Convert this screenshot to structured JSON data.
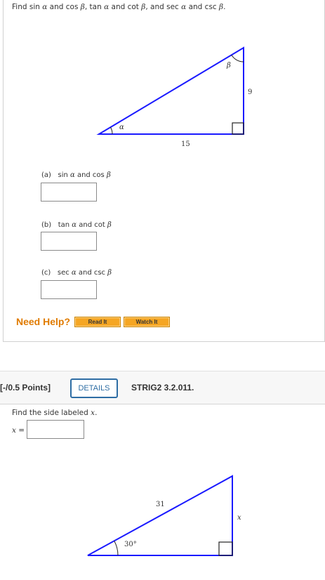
{
  "q1": {
    "prompt": {
      "t1": "Find sin ",
      "a1": "α",
      "t2": " and cos ",
      "b1": "β",
      "t3": ", tan ",
      "a2": "α",
      "t4": " and cot ",
      "b2": "β",
      "t5": ", and sec ",
      "a3": "α",
      "t6": " and csc ",
      "b3": "β",
      "t7": "."
    },
    "figure": {
      "angle_alpha": "α",
      "angle_beta": "β",
      "side_horizontal": "15",
      "side_vertical": "9"
    },
    "parts": [
      {
        "tag": "(a)",
        "pre": "sin ",
        "v1": "α",
        "mid": " and cos ",
        "v2": "β"
      },
      {
        "tag": "(b)",
        "pre": "tan ",
        "v1": "α",
        "mid": " and cot ",
        "v2": "β"
      },
      {
        "tag": "(c)",
        "pre": "sec ",
        "v1": "α",
        "mid": " and csc ",
        "v2": "β"
      }
    ],
    "help": {
      "label": "Need Help?",
      "read_it": "Read It",
      "watch_it": "Watch It"
    }
  },
  "q2": {
    "points": "[-/0.5 Points]",
    "details_label": "DETAILS",
    "code": "STRIG2 3.2.011.",
    "prompt": {
      "text": "Find the side labeled ",
      "var": "x",
      "end": "."
    },
    "answer": {
      "var": "x",
      "eq": " ="
    },
    "figure": {
      "hypotenuse": "31",
      "angle": "30°",
      "side_vertical": "x"
    }
  },
  "colors": {
    "triangle_stroke": "#1a1aff",
    "help_orange": "#e07b00",
    "details_blue": "#2e6da4"
  }
}
